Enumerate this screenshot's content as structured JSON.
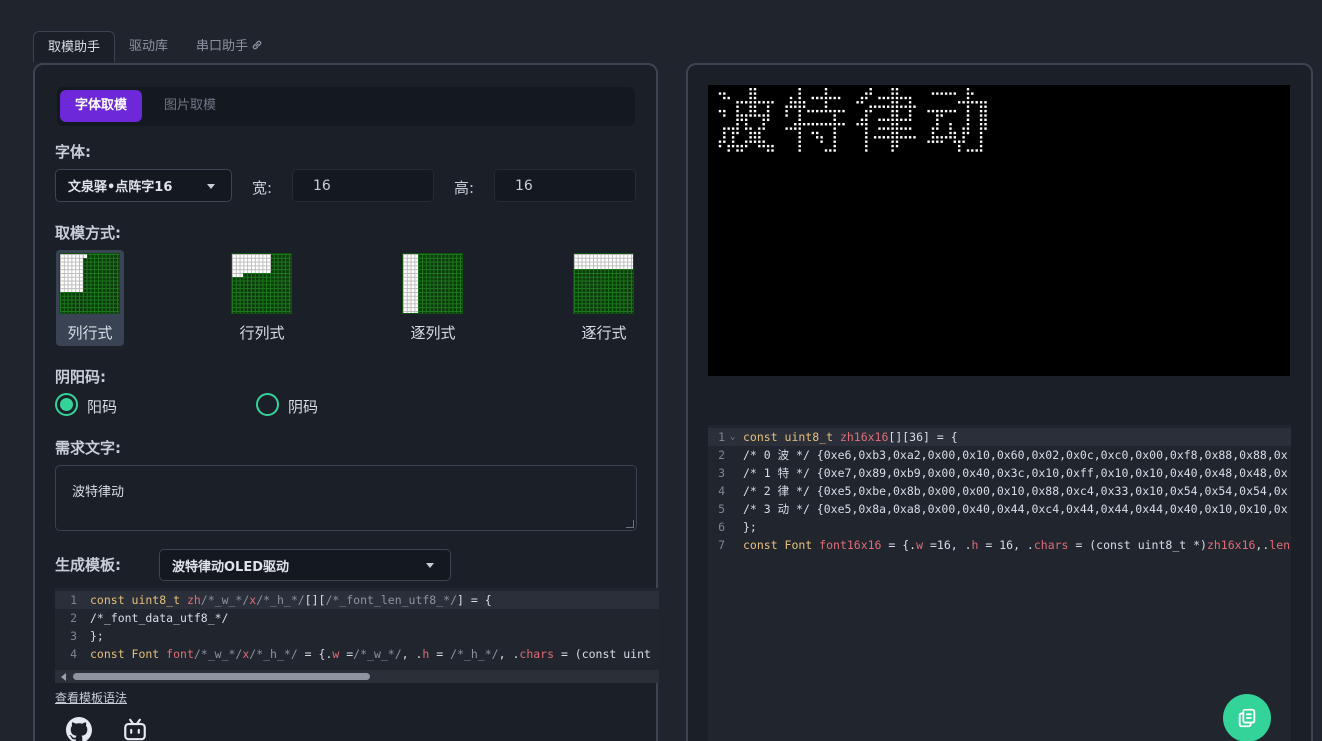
{
  "tabs": [
    {
      "label": "取模助手",
      "active": true
    },
    {
      "label": "驱动库",
      "active": false
    },
    {
      "label": "串口助手",
      "active": false
    }
  ],
  "subtabs": [
    {
      "label": "字体取模",
      "active": true
    },
    {
      "label": "图片取模",
      "active": false
    }
  ],
  "font": {
    "label": "字体:",
    "selected": "文泉驿•点阵字16",
    "width_label": "宽:",
    "width_value": "16",
    "height_label": "高:",
    "height_value": "16"
  },
  "modes": {
    "label": "取模方式:",
    "items": [
      {
        "label": "列行式",
        "active": true
      },
      {
        "label": "行列式",
        "active": false
      },
      {
        "label": "逐列式",
        "active": false
      },
      {
        "label": "逐行式",
        "active": false
      }
    ]
  },
  "polarity": {
    "label": "阴阳码:",
    "options": [
      {
        "label": "阳码",
        "checked": true
      },
      {
        "label": "阴码",
        "checked": false
      }
    ]
  },
  "text": {
    "label": "需求文字:",
    "value": "波特律动"
  },
  "template": {
    "label": "生成模板:",
    "selected": "波特律动OLED驱动",
    "link": "查看模板语法",
    "lines": [
      {
        "n": "1",
        "code": "const uint8_t zh/*_w_*/x/*_h_*/[][/*_font_len_utf8_*/] = {"
      },
      {
        "n": "2",
        "code": "/*_font_data_utf8_*/"
      },
      {
        "n": "3",
        "code": "};"
      },
      {
        "n": "4",
        "code": "const Font font/*_w_*/x/*_h_*/ = {.w =/*_w_*/, .h = /*_h_*/, .chars = (const uint"
      }
    ]
  },
  "preview": {
    "text": "波特律动",
    "bg_color": "#000000",
    "pixel_color": "#ffffff"
  },
  "output": {
    "lines": [
      {
        "n": "1",
        "code": "const uint8_t zh16x16[][36] = {"
      },
      {
        "n": "2",
        "code": "/* 0 波 */ {0xe6,0xb3,0xa2,0x00,0x10,0x60,0x02,0x0c,0xc0,0x00,0xf8,0x88,0x88,0x"
      },
      {
        "n": "3",
        "code": "/* 1 特 */ {0xe7,0x89,0xb9,0x00,0x40,0x3c,0x10,0xff,0x10,0x10,0x40,0x48,0x48,0x"
      },
      {
        "n": "4",
        "code": "/* 2 律 */ {0xe5,0xbe,0x8b,0x00,0x00,0x10,0x88,0xc4,0x33,0x10,0x54,0x54,0x54,0x"
      },
      {
        "n": "5",
        "code": "/* 3 动 */ {0xe5,0x8a,0xa8,0x00,0x40,0x44,0xc4,0x44,0x44,0x44,0x40,0x10,0x10,0x"
      },
      {
        "n": "6",
        "code": "};"
      },
      {
        "n": "7",
        "code": "const Font font16x16 = {.w =16, .h = 16, .chars = (const uint8_t *)zh16x16,.len"
      }
    ]
  },
  "icons": {
    "link": "link-icon",
    "github": "github-icon",
    "bilibili": "bilibili-icon",
    "copy": "copy-icon"
  },
  "colors": {
    "accent_purple": "#6d28d9",
    "accent_green": "#34d399",
    "panel_border": "#3c4453",
    "background": "#1f242d"
  }
}
